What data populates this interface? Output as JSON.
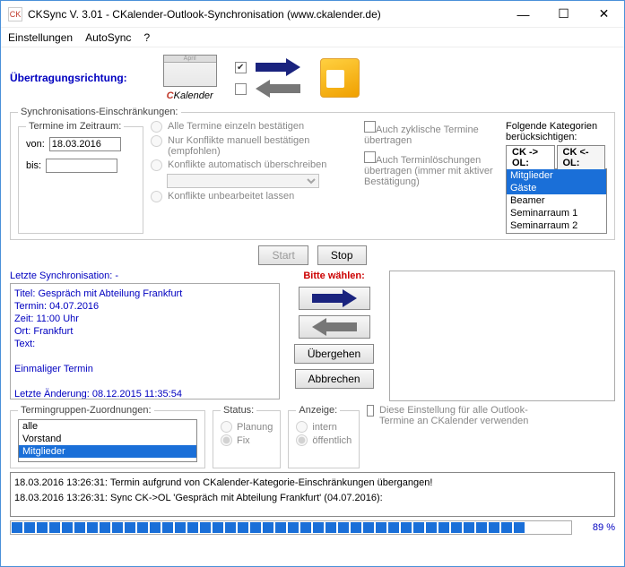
{
  "window": {
    "title": "CKSync V. 3.01 - CKalender-Outlook-Synchronisation (www.ckalender.de)"
  },
  "menu": {
    "settings": "Einstellungen",
    "autosync": "AutoSync",
    "help": "?"
  },
  "direction": {
    "label": "Übertragungsrichtung:",
    "brand_c": "C",
    "brand_rest": "Kalender"
  },
  "constraints": {
    "legend": "Synchronisations-Einschränkungen:",
    "dates_legend": "Termine im Zeitraum:",
    "from_label": "von:",
    "from_value": "18.03.2016",
    "to_label": "bis:",
    "to_value": "",
    "r1": "Alle Termine einzeln bestätigen",
    "r2": "Nur Konflikte manuell bestätigen (empfohlen)",
    "r3": "Konflikte automatisch überschreiben",
    "r4": "Konflikte unbearbeitet lassen",
    "c1": "Auch zyklische Termine übertragen",
    "c2": "Auch Terminlöschungen übertragen (immer mit aktiver Bestätigung)",
    "cat_label": "Folgende Kategorien berücksichtigen:",
    "tab1": "CK -> OL:",
    "tab2": "CK <- OL:",
    "cats": [
      "Mitglieder",
      "Gäste",
      "Beamer",
      "Seminarraum 1",
      "Seminarraum 2"
    ]
  },
  "buttons": {
    "start": "Start",
    "stop": "Stop",
    "skip": "Übergehen",
    "cancel": "Abbrechen"
  },
  "mid": {
    "last_sync": "Letzte Synchronisation: -",
    "bitte": "Bitte wählen:",
    "info_l1": "Titel: Gespräch mit Abteilung Frankfurt",
    "info_l2": "Termin: 04.07.2016",
    "info_l3": "Zeit: 11:00 Uhr",
    "info_l4": "Ort: Frankfurt",
    "info_l5": "Text:",
    "info_l6": "Einmaliger Termin",
    "info_l7": "Letzte Änderung: 08.12.2015 11:35:54"
  },
  "bottom": {
    "term_legend": "Termingruppen-Zuordnungen:",
    "term_items": [
      "alle",
      "Vorstand",
      "Mitglieder"
    ],
    "status_legend": "Status:",
    "status_plan": "Planung",
    "status_fix": "Fix",
    "anz_legend": "Anzeige:",
    "anz_intern": "intern",
    "anz_off": "öffentlich",
    "apply_all": "Diese Einstellung für alle Outlook-Termine an CKalender verwenden"
  },
  "log": {
    "l1": "18.03.2016 13:26:31: Termin aufgrund von CKalender-Kategorie-Einschränkungen übergangen!",
    "l2": "18.03.2016 13:26:31: Sync CK->OL 'Gespräch mit Abteilung Frankfurt' (04.07.2016):"
  },
  "progress": {
    "pct": "89 %"
  }
}
